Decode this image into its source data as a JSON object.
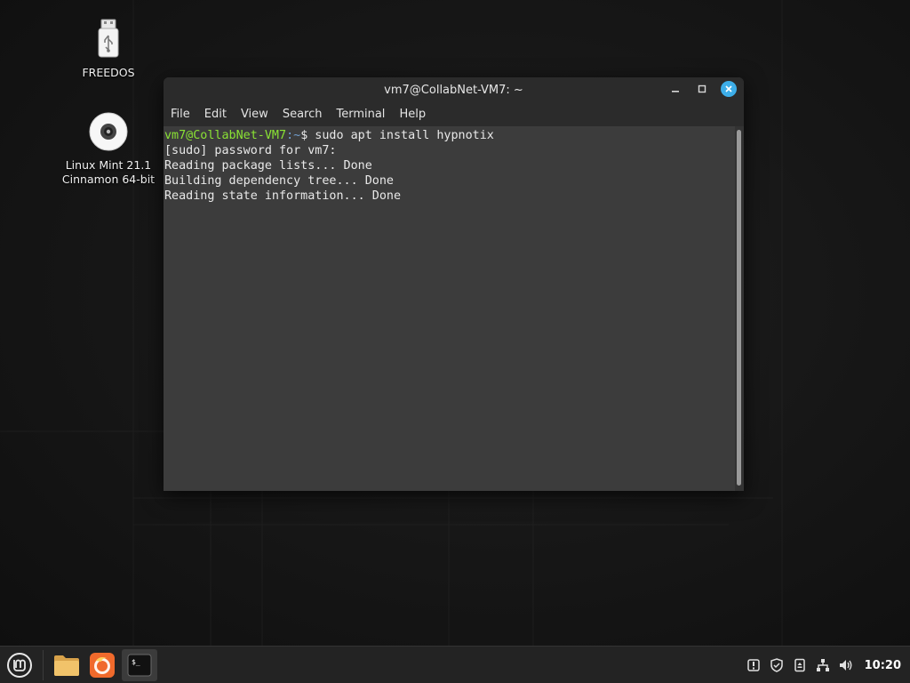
{
  "desktop": {
    "icons": [
      {
        "label": "FREEDOS"
      },
      {
        "label_line1": "Linux Mint 21.1",
        "label_line2": "Cinnamon 64-bit"
      }
    ]
  },
  "terminal_window": {
    "title": "vm7@CollabNet-VM7: ~",
    "controls": {
      "minimize": "minimize",
      "maximize": "maximize",
      "close": "close"
    },
    "menu": [
      "File",
      "Edit",
      "View",
      "Search",
      "Terminal",
      "Help"
    ],
    "lines": {
      "prompt_user": "vm7@CollabNet-VM7",
      "prompt_path": ":~",
      "prompt_command": "$ sudo apt install hypnotix",
      "line2": "[sudo] password for vm7:",
      "line3": "Reading package lists... Done",
      "line4": "Building dependency tree... Done",
      "line5": "Reading state information... Done"
    }
  },
  "taskbar": {
    "apps": [
      {
        "name": "menu-icon"
      },
      {
        "name": "folder-icon"
      },
      {
        "name": "firefox-icon"
      },
      {
        "name": "terminal-icon",
        "active": true
      }
    ],
    "clock": "10:20"
  },
  "colors": {
    "prompt_user": "#8ae234",
    "prompt_path": "#729fcf",
    "close_button": "#3daee9",
    "mint_green": "#87cf3e"
  }
}
